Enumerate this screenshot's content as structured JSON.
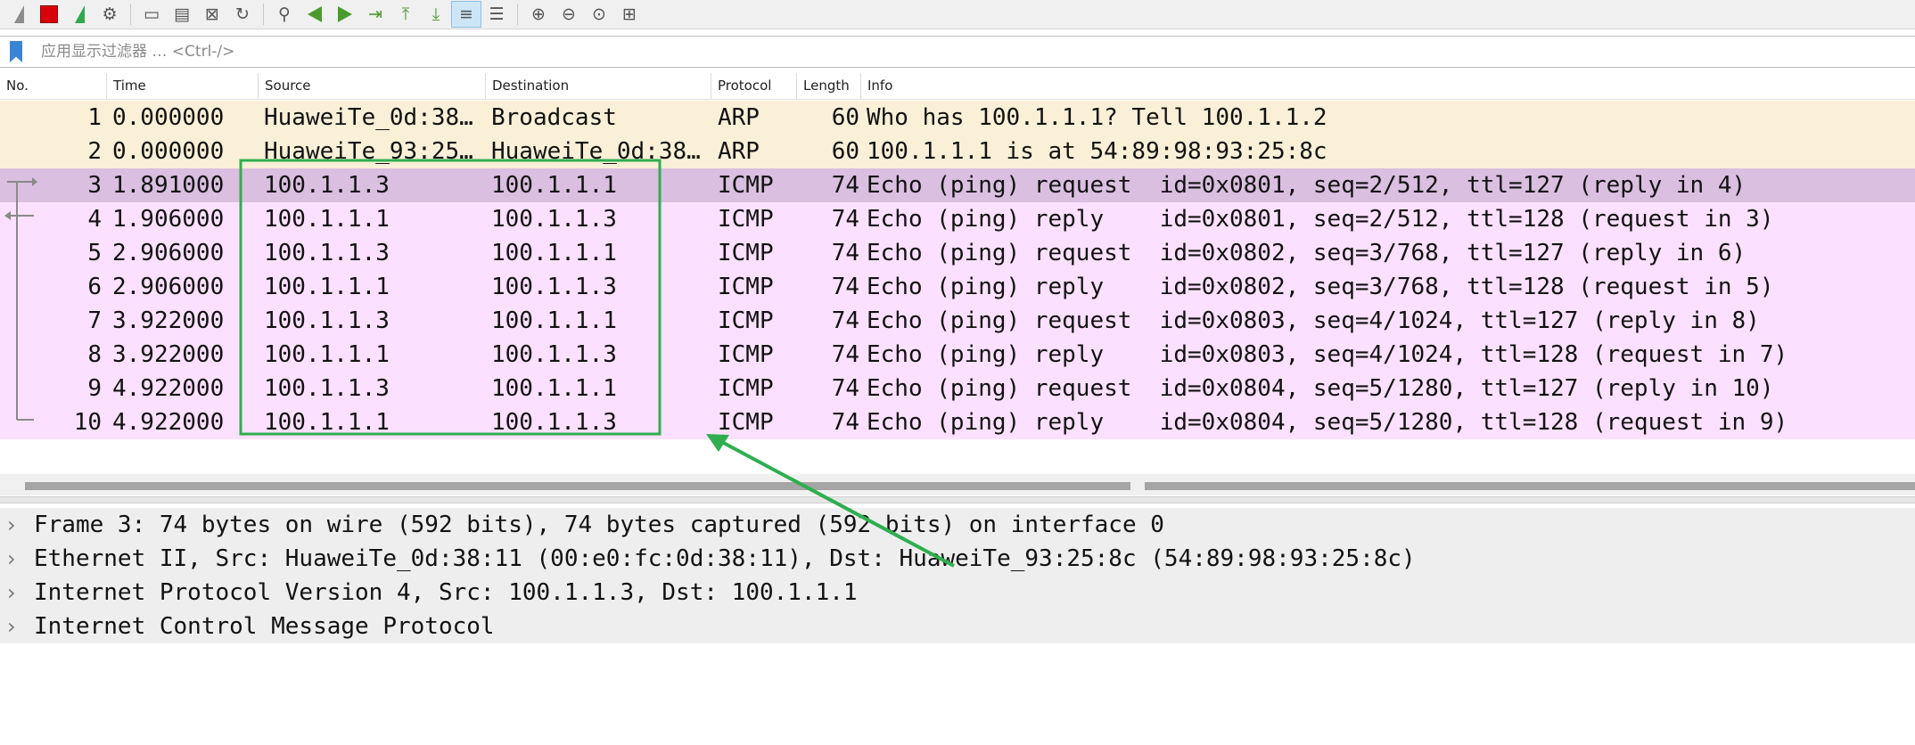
{
  "toolbar": {
    "buttons": [
      {
        "name": "start-capture-icon"
      },
      {
        "name": "stop-capture-icon"
      },
      {
        "name": "restart-capture-icon"
      },
      {
        "name": "capture-options-icon"
      },
      {
        "name": "open-file-icon"
      },
      {
        "name": "save-file-icon"
      },
      {
        "name": "close-file-icon"
      },
      {
        "name": "reload-file-icon"
      },
      {
        "name": "find-packet-icon"
      },
      {
        "name": "go-back-icon"
      },
      {
        "name": "go-forward-icon"
      },
      {
        "name": "go-to-packet-icon"
      },
      {
        "name": "go-first-packet-icon"
      },
      {
        "name": "go-last-packet-icon"
      },
      {
        "name": "auto-scroll-icon",
        "active": true
      },
      {
        "name": "colorize-icon"
      },
      {
        "name": "zoom-in-icon"
      },
      {
        "name": "zoom-out-icon"
      },
      {
        "name": "normal-size-icon"
      },
      {
        "name": "resize-columns-icon"
      }
    ]
  },
  "filter": {
    "placeholder": "应用显示过滤器 … <Ctrl-/>",
    "value": ""
  },
  "columns": {
    "no": "No.",
    "time": "Time",
    "source": "Source",
    "destination": "Destination",
    "protocol": "Protocol",
    "length": "Length",
    "info": "Info"
  },
  "colors": {
    "arp_row": "#faf0d7",
    "icmp_row": "#fce0ff",
    "selected_row": "#dabfe0",
    "annotation": "#2fae50"
  },
  "packets": [
    {
      "no": "1",
      "time": "0.000000",
      "source": "HuaweiTe_0d:38…",
      "destination": "Broadcast",
      "protocol": "ARP",
      "length": "60",
      "info": "Who has 100.1.1.1? Tell 100.1.1.2"
    },
    {
      "no": "2",
      "time": "0.000000",
      "source": "HuaweiTe_93:25…",
      "destination": "HuaweiTe_0d:38…",
      "protocol": "ARP",
      "length": "60",
      "info": "100.1.1.1 is at 54:89:98:93:25:8c"
    },
    {
      "no": "3",
      "time": "1.891000",
      "source": "100.1.1.3",
      "destination": "100.1.1.1",
      "protocol": "ICMP",
      "length": "74",
      "info": "Echo (ping) request  id=0x0801, seq=2/512, ttl=127 (reply in 4)"
    },
    {
      "no": "4",
      "time": "1.906000",
      "source": "100.1.1.1",
      "destination": "100.1.1.3",
      "protocol": "ICMP",
      "length": "74",
      "info": "Echo (ping) reply    id=0x0801, seq=2/512, ttl=128 (request in 3)"
    },
    {
      "no": "5",
      "time": "2.906000",
      "source": "100.1.1.3",
      "destination": "100.1.1.1",
      "protocol": "ICMP",
      "length": "74",
      "info": "Echo (ping) request  id=0x0802, seq=3/768, ttl=127 (reply in 6)"
    },
    {
      "no": "6",
      "time": "2.906000",
      "source": "100.1.1.1",
      "destination": "100.1.1.3",
      "protocol": "ICMP",
      "length": "74",
      "info": "Echo (ping) reply    id=0x0802, seq=3/768, ttl=128 (request in 5)"
    },
    {
      "no": "7",
      "time": "3.922000",
      "source": "100.1.1.3",
      "destination": "100.1.1.1",
      "protocol": "ICMP",
      "length": "74",
      "info": "Echo (ping) request  id=0x0803, seq=4/1024, ttl=127 (reply in 8)"
    },
    {
      "no": "8",
      "time": "3.922000",
      "source": "100.1.1.1",
      "destination": "100.1.1.3",
      "protocol": "ICMP",
      "length": "74",
      "info": "Echo (ping) reply    id=0x0803, seq=4/1024, ttl=128 (request in 7)"
    },
    {
      "no": "9",
      "time": "4.922000",
      "source": "100.1.1.3",
      "destination": "100.1.1.1",
      "protocol": "ICMP",
      "length": "74",
      "info": "Echo (ping) request  id=0x0804, seq=5/1280, ttl=127 (reply in 10)"
    },
    {
      "no": "10",
      "time": "4.922000",
      "source": "100.1.1.1",
      "destination": "100.1.1.3",
      "protocol": "ICMP",
      "length": "74",
      "info": "Echo (ping) reply    id=0x0804, seq=5/1280, ttl=128 (request in 9)"
    }
  ],
  "selected_packet": "3",
  "details": [
    "Frame 3: 74 bytes on wire (592 bits), 74 bytes captured (592 bits) on interface 0",
    "Ethernet II, Src: HuaweiTe_0d:38:11 (00:e0:fc:0d:38:11), Dst: HuaweiTe_93:25:8c (54:89:98:93:25:8c)",
    "Internet Protocol Version 4, Src: 100.1.1.3, Dst: 100.1.1.1",
    "Internet Control Message Protocol"
  ]
}
